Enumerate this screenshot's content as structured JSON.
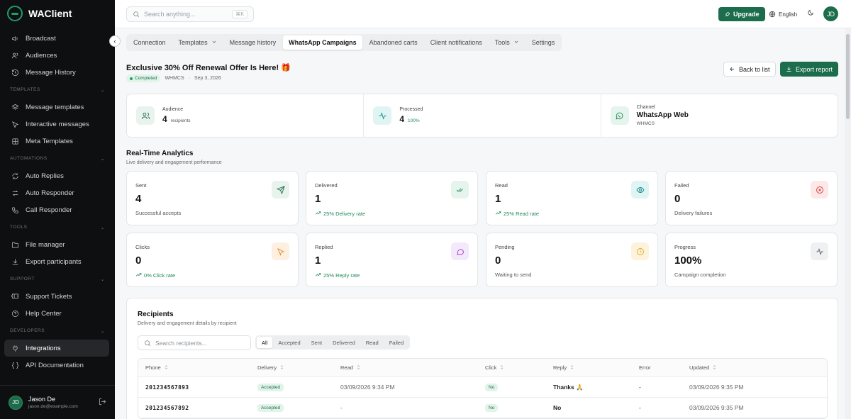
{
  "app": {
    "name": "WAClient"
  },
  "sidebar": {
    "items_top": [
      {
        "label": "Broadcast",
        "icon": "megaphone-icon"
      },
      {
        "label": "Audiences",
        "icon": "users-icon"
      },
      {
        "label": "Message History",
        "icon": "history-icon"
      }
    ],
    "sections": [
      {
        "title": "TEMPLATES",
        "items": [
          {
            "label": "Message templates",
            "icon": "layers-icon"
          },
          {
            "label": "Interactive messages",
            "icon": "pointer-icon"
          },
          {
            "label": "Meta Templates",
            "icon": "grid-icon"
          }
        ]
      },
      {
        "title": "AUTOMATIONS",
        "items": [
          {
            "label": "Auto Replies",
            "icon": "refresh-icon"
          },
          {
            "label": "Auto Responder",
            "icon": "swap-icon"
          },
          {
            "label": "Call Responder",
            "icon": "phone-icon"
          }
        ]
      },
      {
        "title": "TOOLS",
        "items": [
          {
            "label": "File manager",
            "icon": "folder-icon"
          },
          {
            "label": "Export participants",
            "icon": "download-icon"
          }
        ]
      },
      {
        "title": "SUPPORT",
        "items": [
          {
            "label": "Support Tickets",
            "icon": "ticket-icon"
          },
          {
            "label": "Help Center",
            "icon": "help-icon"
          }
        ]
      },
      {
        "title": "DEVELOPERS",
        "items": [
          {
            "label": "Integrations",
            "icon": "plug-icon",
            "active": true
          },
          {
            "label": "API Documentation",
            "icon": "braces-icon"
          }
        ]
      }
    ],
    "user": {
      "initials": "JD",
      "name": "Jason De",
      "email": "jason.de@example.com"
    }
  },
  "topbar": {
    "search_placeholder": "Search anything...",
    "shortcut": "⌘K",
    "upgrade": "Upgrade",
    "language": "English",
    "avatar": "JD"
  },
  "tabs": [
    {
      "label": "Connection"
    },
    {
      "label": "Templates",
      "dropdown": true
    },
    {
      "label": "Message history"
    },
    {
      "label": "WhatsApp Campaigns",
      "active": true
    },
    {
      "label": "Abandoned carts"
    },
    {
      "label": "Client notifications"
    },
    {
      "label": "Tools",
      "dropdown": true
    },
    {
      "label": "Settings"
    }
  ],
  "campaign": {
    "title": "Exclusive 30% Off Renewal Offer Is Here!",
    "title_emoji": "🎁",
    "status": "Completed",
    "source": "WHMCS",
    "date": "Sep 3, 2026",
    "back_label": "Back to list",
    "export_label": "Export report"
  },
  "summary": {
    "audience": {
      "label": "Audience",
      "value": "4",
      "unit": "recipients"
    },
    "processed": {
      "label": "Processed",
      "value": "4",
      "unit": "100%"
    },
    "channel": {
      "label": "Channel",
      "value": "WhatsApp Web",
      "sub": "WHMCS"
    }
  },
  "analytics": {
    "title": "Real-Time Analytics",
    "subtitle": "Live delivery and engagement performance",
    "cards": [
      {
        "label": "Sent",
        "value": "4",
        "foot": "Successful accepts",
        "trend": false,
        "icon": "send-icon",
        "color": "#1c6d4c",
        "bg": "#e8f3ee"
      },
      {
        "label": "Delivered",
        "value": "1",
        "foot": "25% Delivery rate",
        "trend": true,
        "icon": "double-check-icon",
        "color": "#1f8a5a",
        "bg": "#e5f4ec"
      },
      {
        "label": "Read",
        "value": "1",
        "foot": "25% Read rate",
        "trend": true,
        "icon": "eye-icon",
        "color": "#0f8b8d",
        "bg": "#e0f4f4"
      },
      {
        "label": "Failed",
        "value": "0",
        "foot": "Delivery failures",
        "trend": false,
        "icon": "x-circle-icon",
        "color": "#d93b3b",
        "bg": "#fde8e8"
      },
      {
        "label": "Clicks",
        "value": "0",
        "foot": "0% Click rate",
        "trend": true,
        "icon": "cursor-icon",
        "color": "#e0851f",
        "bg": "#fdf0e1"
      },
      {
        "label": "Replied",
        "value": "1",
        "foot": "25% Reply rate",
        "trend": true,
        "icon": "chat-icon",
        "color": "#9a3fc7",
        "bg": "#f4e8fb"
      },
      {
        "label": "Pending",
        "value": "0",
        "foot": "Waiting to send",
        "trend": false,
        "icon": "clock-icon",
        "color": "#e0a51f",
        "bg": "#fdf3dc"
      },
      {
        "label": "Progress",
        "value": "100%",
        "foot": "Campaign completion",
        "trend": false,
        "icon": "activity-icon",
        "color": "#555b61",
        "bg": "#eef0f2"
      }
    ]
  },
  "recipients": {
    "title": "Recipients",
    "subtitle": "Delivery and engagement details by recipient",
    "search_placeholder": "Search recipients...",
    "filters": [
      "All",
      "Accepted",
      "Sent",
      "Delivered",
      "Read",
      "Failed"
    ],
    "columns": [
      "Phone",
      "Delivery",
      "Read",
      "Click",
      "Reply",
      "Error",
      "Updated"
    ],
    "rows": [
      {
        "phone": "201234567893",
        "delivery": "Accepted",
        "read": "03/09/2026 9:34 PM",
        "click": "No",
        "reply": "Thanks 🙏",
        "error": "-",
        "updated": "03/09/2026 9:35 PM"
      },
      {
        "phone": "201234567892",
        "delivery": "Accepted",
        "read": "-",
        "click": "No",
        "reply": "No",
        "error": "-",
        "updated": "03/09/2026 9:35 PM"
      }
    ]
  }
}
